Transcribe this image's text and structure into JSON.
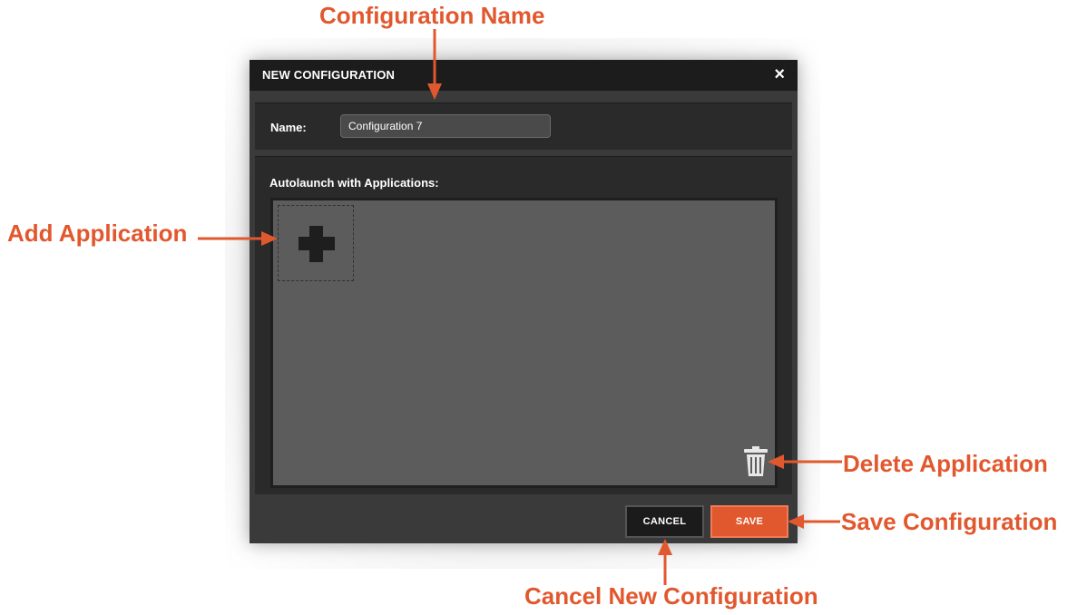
{
  "dialog": {
    "title": "NEW CONFIGURATION",
    "close_symbol": "×",
    "name_label": "Name:",
    "name_value": "Configuration 7",
    "apps_label": "Autolaunch with Applications:",
    "add_icon": "plus-icon",
    "delete_icon": "trash-icon",
    "cancel_label": "CANCEL",
    "save_label": "SAVE"
  },
  "callouts": {
    "configuration_name": "Configuration Name",
    "add_application": "Add Application",
    "delete_application": "Delete Application",
    "save_configuration": "Save Configuration",
    "cancel_new_configuration": "Cancel New Configuration"
  },
  "colors": {
    "accent": "#e2582e",
    "titlebar": "#1c1c1c",
    "panel": "#2a2a2a",
    "apps_area": "#5c5c5c"
  }
}
